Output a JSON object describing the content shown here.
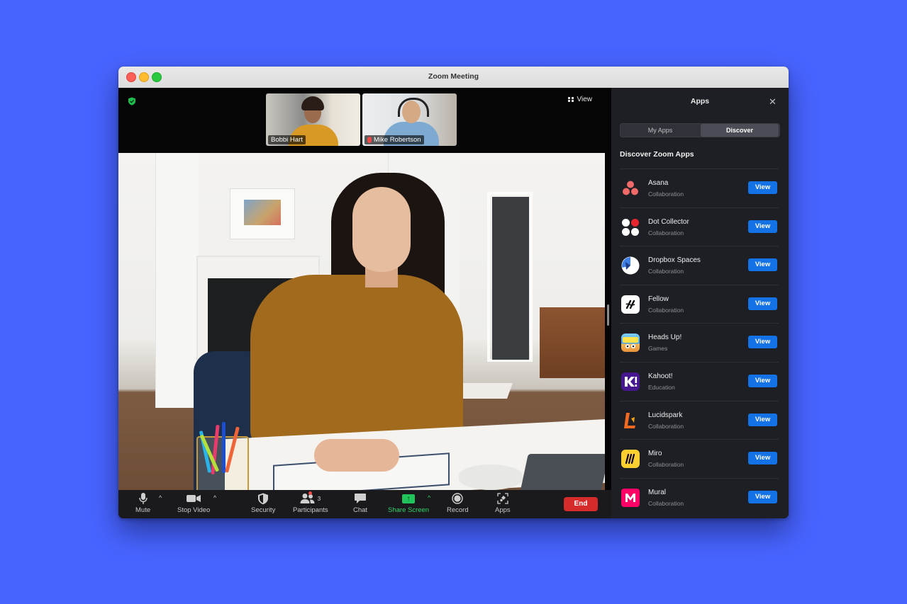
{
  "window": {
    "title": "Zoom Meeting"
  },
  "meeting": {
    "view_label": "View",
    "participants": [
      {
        "name": "Bobbi Hart",
        "muted": false
      },
      {
        "name": "Mike Robertson",
        "muted": true
      }
    ]
  },
  "toolbar": {
    "mute": "Mute",
    "stop_video": "Stop Video",
    "security": "Security",
    "participants": "Participants",
    "participants_count": "3",
    "chat": "Chat",
    "share_screen": "Share Screen",
    "record": "Record",
    "apps": "Apps",
    "end": "End"
  },
  "panel": {
    "title": "Apps",
    "tabs": [
      "My Apps",
      "Discover"
    ],
    "active_tab": "Discover",
    "section_title": "Discover Zoom Apps",
    "view_label": "View",
    "apps": [
      {
        "name": "Asana",
        "category": "Collaboration",
        "icon": "asana-icon"
      },
      {
        "name": "Dot Collector",
        "category": "Collaboration",
        "icon": "dot-collector-icon"
      },
      {
        "name": "Dropbox Spaces",
        "category": "Collaboration",
        "icon": "dropbox-spaces-icon"
      },
      {
        "name": "Fellow",
        "category": "Collaboration",
        "icon": "fellow-icon"
      },
      {
        "name": "Heads Up!",
        "category": "Games",
        "icon": "heads-up-icon"
      },
      {
        "name": "Kahoot!",
        "category": "Education",
        "icon": "kahoot-icon"
      },
      {
        "name": "Lucidspark",
        "category": "Collaboration",
        "icon": "lucidspark-icon"
      },
      {
        "name": "Miro",
        "category": "Collaboration",
        "icon": "miro-icon"
      },
      {
        "name": "Mural",
        "category": "Collaboration",
        "icon": "mural-icon"
      }
    ]
  },
  "colors": {
    "background": "#4764ff",
    "accent_blue": "#1272e6",
    "end_red": "#d52b2b",
    "share_green": "#21c35c",
    "panel_bg": "#1d1f24"
  }
}
